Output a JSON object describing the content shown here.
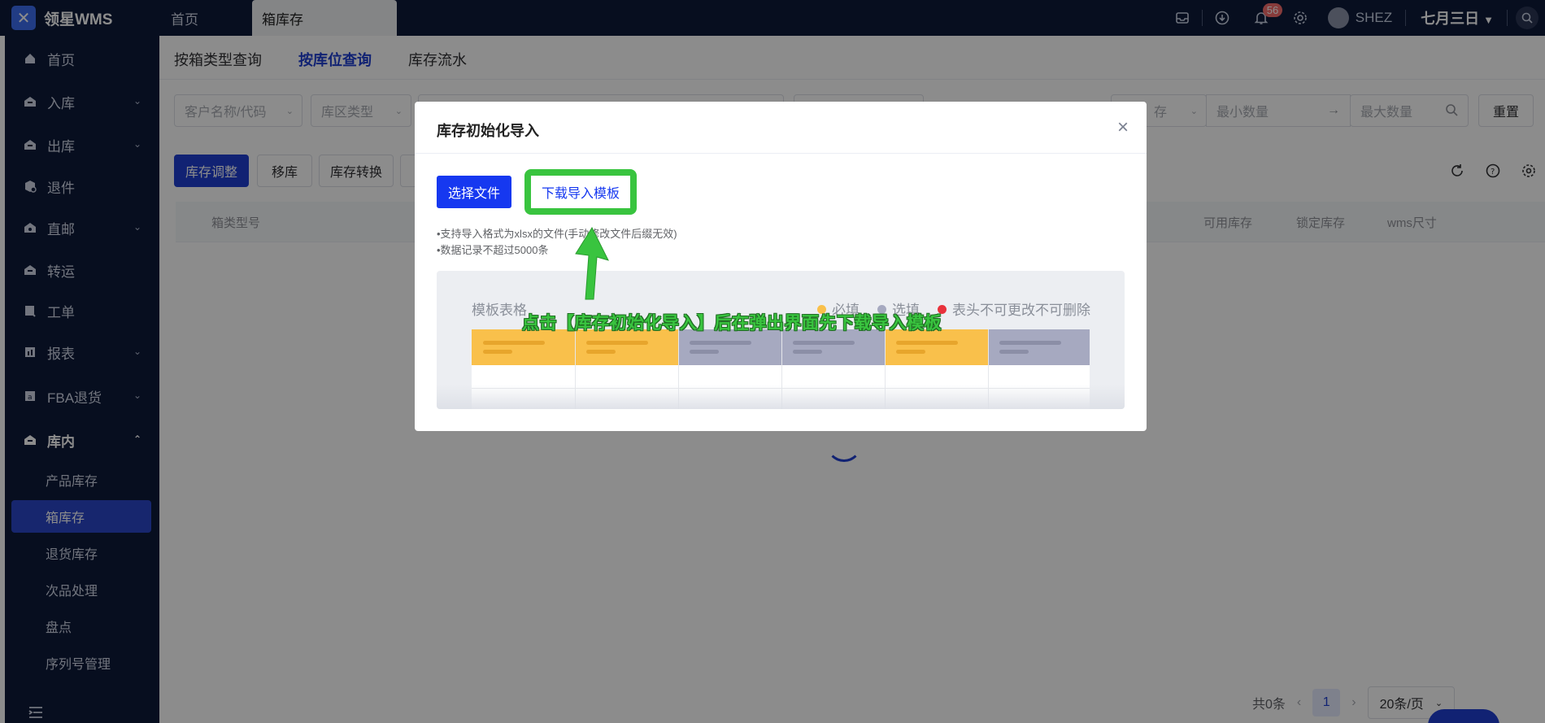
{
  "brand": {
    "name": "领星WMS"
  },
  "top_tabs": {
    "home": "首页",
    "active": "箱库存"
  },
  "top_right": {
    "notifications": "56",
    "username": "SHEZ",
    "menu": "七月三日"
  },
  "sidebar": {
    "items": [
      {
        "label": "首页"
      },
      {
        "label": "入库"
      },
      {
        "label": "出库"
      },
      {
        "label": "退件"
      },
      {
        "label": "直邮"
      },
      {
        "label": "转运"
      },
      {
        "label": "工单"
      },
      {
        "label": "报表"
      },
      {
        "label": "FBA退货"
      },
      {
        "label": "库内"
      }
    ],
    "sub_items": [
      {
        "label": "产品库存"
      },
      {
        "label": "箱库存"
      },
      {
        "label": "退货库存"
      },
      {
        "label": "次品处理"
      },
      {
        "label": "盘点"
      },
      {
        "label": "序列号管理"
      }
    ]
  },
  "main": {
    "tabs": [
      {
        "label": "按箱类型查询"
      },
      {
        "label": "按库位查询"
      },
      {
        "label": "库存流水"
      }
    ],
    "filters": {
      "customer": "客户名称/代码",
      "zone_type": "库区类型",
      "stock_type": "存",
      "min_qty": "最小数量",
      "max_qty": "最大数量",
      "reset": "重置"
    },
    "toolbar": {
      "adjust": "库存调整",
      "move": "移库",
      "convert": "库存转换"
    },
    "table_head": {
      "col1": "箱类型号",
      "col_avail": "可用库存",
      "col_locked": "锁定库存",
      "col_size": "wms尺寸"
    },
    "pager": {
      "total": "共0条",
      "current": "1",
      "size": "20条/页"
    }
  },
  "dialog": {
    "title": "库存初始化导入",
    "choose_file": "选择文件",
    "download_template": "下载导入模板",
    "hint1": "•支持导入格式为xlsx的文件(手动修改文件后缀无效)",
    "hint2": "•数据记录不超过5000条",
    "preview": {
      "title": "模板表格",
      "legend_required": "必填",
      "legend_optional": "选填",
      "legend_locked": "表头不可更改不可删除"
    }
  },
  "annotation": {
    "text": "点击【库存初始化导入】后在弹出界面先下载导入模板"
  },
  "colors": {
    "accent": "#1638f0",
    "nav_bg": "#0d1a3a",
    "highlight": "#39c43f",
    "required": "#f9c04b",
    "optional": "#a6a9c0",
    "locked": "#e8323c"
  }
}
